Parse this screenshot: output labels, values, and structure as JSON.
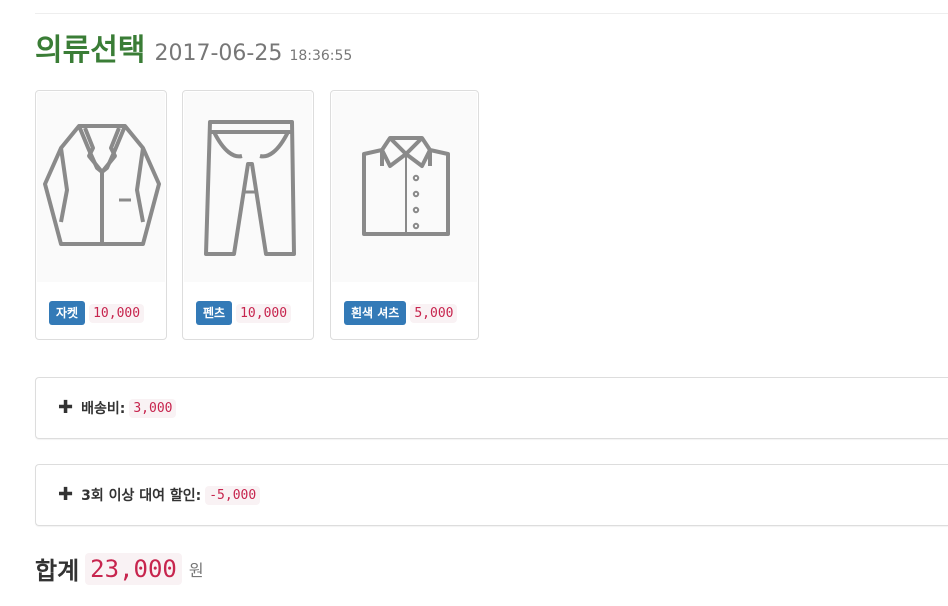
{
  "header": {
    "title": "의류선택",
    "date": "2017-06-25",
    "time": "18:36:55"
  },
  "items": [
    {
      "name": "자켓",
      "price": "10,000",
      "icon": "jacket-icon"
    },
    {
      "name": "펜츠",
      "price": "10,000",
      "icon": "pants-icon"
    },
    {
      "name": "흰색 셔츠",
      "price": "5,000",
      "icon": "shirt-icon"
    }
  ],
  "shipping": {
    "label": "배송비:",
    "value": "3,000",
    "icon": "plus-icon"
  },
  "discount": {
    "label": "3회 이상 대여 할인:",
    "value": "-5,000",
    "icon": "plus-icon"
  },
  "total": {
    "label": "합계",
    "value": "23,000",
    "unit": "원"
  },
  "colors": {
    "title": "#3a7d36",
    "label_bg": "#337ab7",
    "code_text": "#c7254e",
    "code_bg": "#f9f2f4"
  }
}
